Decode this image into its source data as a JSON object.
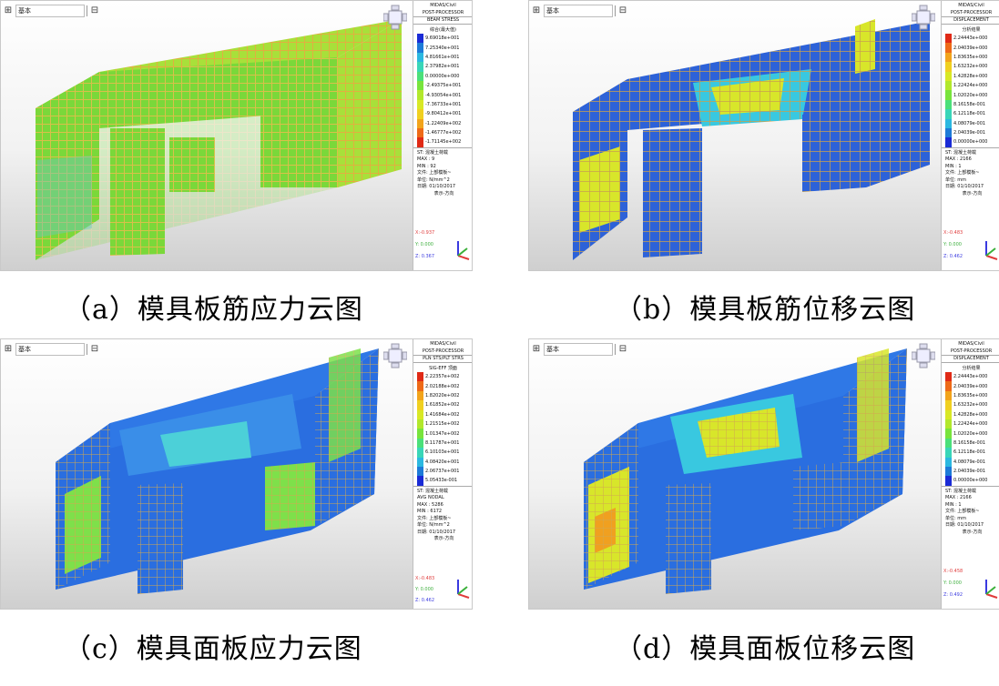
{
  "panels": {
    "a": {
      "toolbar": {
        "select_value": "基本"
      },
      "legend": {
        "program": "MIDAS/Civil",
        "module": "POST-PROCESSOR",
        "result_type": "BEAM STRESS",
        "component": "综合(最大值)",
        "values": [
          "9.69018e+001",
          "7.25340e+001",
          "4.81661e+001",
          "2.37982e+001",
          "0.00000e+000",
          "-2.49375e+001",
          "-4.93054e+001",
          "-7.36733e+001",
          "-9.80412e+001",
          "-1.22409e+002",
          "-1.46777e+002",
          "-1.71145e+002"
        ],
        "colors": [
          "#1a2bd6",
          "#1d7bd8",
          "#2bb8e0",
          "#39d6b8",
          "#4be07a",
          "#78e43c",
          "#b2e82c",
          "#d8e826",
          "#f0d020",
          "#f2a41c",
          "#ee6a18",
          "#e02a16"
        ],
        "load_case": "ST: 混凝土荷载",
        "max": "MAX : 9",
        "min": "MIN : 92",
        "file": "文件: 上部模板~",
        "unit": "单位: N/mm^2",
        "date": "日期: 01/10/2017",
        "direction": "表示-方向",
        "axis_x": "X:-0.937",
        "axis_y": "Y: 0.000",
        "axis_z": "Z: 0.367"
      },
      "caption": "（a）模具板筋应力云图"
    },
    "b": {
      "toolbar": {
        "select_value": "基本"
      },
      "legend": {
        "program": "MIDAS/Civil",
        "module": "POST-PROCESSOR",
        "result_type": "DISPLACEMENT",
        "component": "分析结果",
        "values": [
          "2.24443e+000",
          "2.04039e+000",
          "1.83635e+000",
          "1.63232e+000",
          "1.42828e+000",
          "1.22424e+000",
          "1.02020e+000",
          "8.16158e-001",
          "6.12118e-001",
          "4.08079e-001",
          "2.04039e-001",
          "0.00000e+000"
        ],
        "colors": [
          "#e02a16",
          "#ee6a18",
          "#f2a41c",
          "#f0d020",
          "#d8e826",
          "#b2e82c",
          "#78e43c",
          "#4be07a",
          "#39d6b8",
          "#2bb8e0",
          "#1d7bd8",
          "#1a2bd6"
        ],
        "load_case": "ST: 混凝土荷载",
        "max": "MAX : 2166",
        "min": "MIN : 1",
        "file": "文件: 上部模板~",
        "unit": "单位: mm",
        "date": "日期: 01/10/2017",
        "direction": "表示-方向",
        "axis_x": "X:-0.483",
        "axis_y": "Y: 0.000",
        "axis_z": "Z: 0.462"
      },
      "caption": "（b）模具板筋位移云图"
    },
    "c": {
      "toolbar": {
        "select_value": "基本"
      },
      "legend": {
        "program": "MIDAS/Civil",
        "module": "POST-PROCESSOR",
        "result_type": "PLN STS/PLT STRS",
        "component": "SIG-EFF 顶面",
        "values": [
          "2.22357e+002",
          "2.02188e+002",
          "1.82020e+002",
          "1.61852e+002",
          "1.41684e+002",
          "1.21515e+002",
          "1.01347e+002",
          "8.11787e+001",
          "6.10103e+001",
          "4.08420e+001",
          "2.06737e+001",
          "5.05433e-001"
        ],
        "colors": [
          "#e02a16",
          "#ee6a18",
          "#f2a41c",
          "#f0d020",
          "#d8e826",
          "#b2e82c",
          "#78e43c",
          "#4be07a",
          "#39d6b8",
          "#2bb8e0",
          "#1d7bd8",
          "#1a2bd6"
        ],
        "load_case": "ST: 混凝土荷载",
        "avg": "AVG NODAL",
        "max": "MAX : 5286",
        "min": "MIN : 6172",
        "file": "文件: 上部模板~",
        "unit": "单位: N/mm^2",
        "date": "日期: 01/10/2017",
        "direction": "表示-方向",
        "axis_x": "X:-0.483",
        "axis_y": "Y: 0.000",
        "axis_z": "Z: 0.462"
      },
      "caption": "（c）模具面板应力云图"
    },
    "d": {
      "toolbar": {
        "select_value": "基本"
      },
      "legend": {
        "program": "MIDAS/Civil",
        "module": "POST-PROCESSOR",
        "result_type": "DISPLACEMENT",
        "component": "分析结果",
        "values": [
          "2.24443e+000",
          "2.04039e+000",
          "1.83635e+000",
          "1.63232e+000",
          "1.42828e+000",
          "1.22424e+000",
          "1.02020e+000",
          "8.16158e-001",
          "6.12118e-001",
          "4.08079e-001",
          "2.04039e-001",
          "0.00000e+000"
        ],
        "colors": [
          "#e02a16",
          "#ee6a18",
          "#f2a41c",
          "#f0d020",
          "#d8e826",
          "#b2e82c",
          "#78e43c",
          "#4be07a",
          "#39d6b8",
          "#2bb8e0",
          "#1d7bd8",
          "#1a2bd6"
        ],
        "load_case": "ST: 混凝土荷载",
        "max": "MAX : 2166",
        "min": "MIN : 1",
        "file": "文件: 上部模板~",
        "unit": "单位: mm",
        "date": "日期: 01/10/2017",
        "direction": "表示-方向",
        "axis_x": "X:-0.458",
        "axis_y": "Y: 0.000",
        "axis_z": "Z: 0.492"
      },
      "caption": "（d）模具面板位移云图"
    }
  }
}
